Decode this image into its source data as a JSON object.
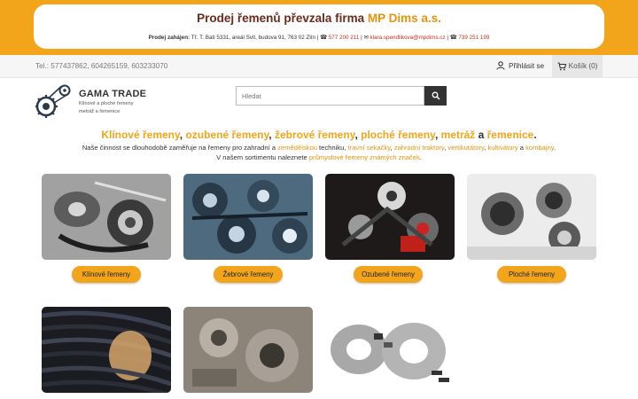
{
  "banner": {
    "title_prefix": "Prodej řemenů převzala firma ",
    "title_brand": "MP Dims a.s.",
    "info_label": "Prodej zahájen:",
    "info_address": " Tř. T. Bati 5331, areál Svit, budova 91, 763 02 Zlín | ",
    "phone1": "577 200 211",
    "email": "klara.spendlikova@mpdims.cz",
    "phone2": "739 251 199"
  },
  "topbar": {
    "phones": "Tel.: 577437862, 604265159, 603233070",
    "login_label": "Přihlásit se",
    "cart_label": "Košík (0)"
  },
  "header": {
    "logo_title": "GAMA TRADE",
    "logo_sub1": "Klínové a ploché řemeny",
    "logo_sub2": "metráž a řemenice",
    "search_placeholder": "Hledat"
  },
  "intro": {
    "h1": "Klínové řemeny",
    "h_sep1": ", ",
    "h2": "ozubené řemeny",
    "h3": "žebrové řemeny",
    "h4": "ploché řemeny",
    "h5": "metráž",
    "h_and": " a ",
    "h6": "řemenice",
    "h_end": ".",
    "line1_a": "Naše činnost se dlouhodobě zaměřuje na řemeny pro zahradní a ",
    "line1_b": "zemědělskou",
    "line1_c": " techniku, ",
    "line1_d": "travní sekačky",
    "line1_e": ", ",
    "line1_f": "zahradní traktory",
    "line1_g": ", ",
    "line1_h": "vertikutátory",
    "line1_i": ", ",
    "line1_j": "kultivátory",
    "line1_k": " a ",
    "line1_l": "kombajny",
    "line1_m": ".",
    "line2_a": "V našem sortimentu naleznete ",
    "line2_b": "průmyslové řemeny známých značek",
    "line2_c": "."
  },
  "categories": [
    {
      "label": "Klínové řemeny"
    },
    {
      "label": "Žebrové řemeny"
    },
    {
      "label": "Ozubené řemeny"
    },
    {
      "label": "Ploché řemeny"
    }
  ],
  "icons": {
    "login": "user-icon",
    "cart": "cart-icon",
    "search": "search-icon",
    "phone": "phone-icon",
    "mail": "mail-icon"
  },
  "colors": {
    "accent": "#f2a51a",
    "banner_title": "#6b2a1a",
    "dark": "#333333"
  }
}
